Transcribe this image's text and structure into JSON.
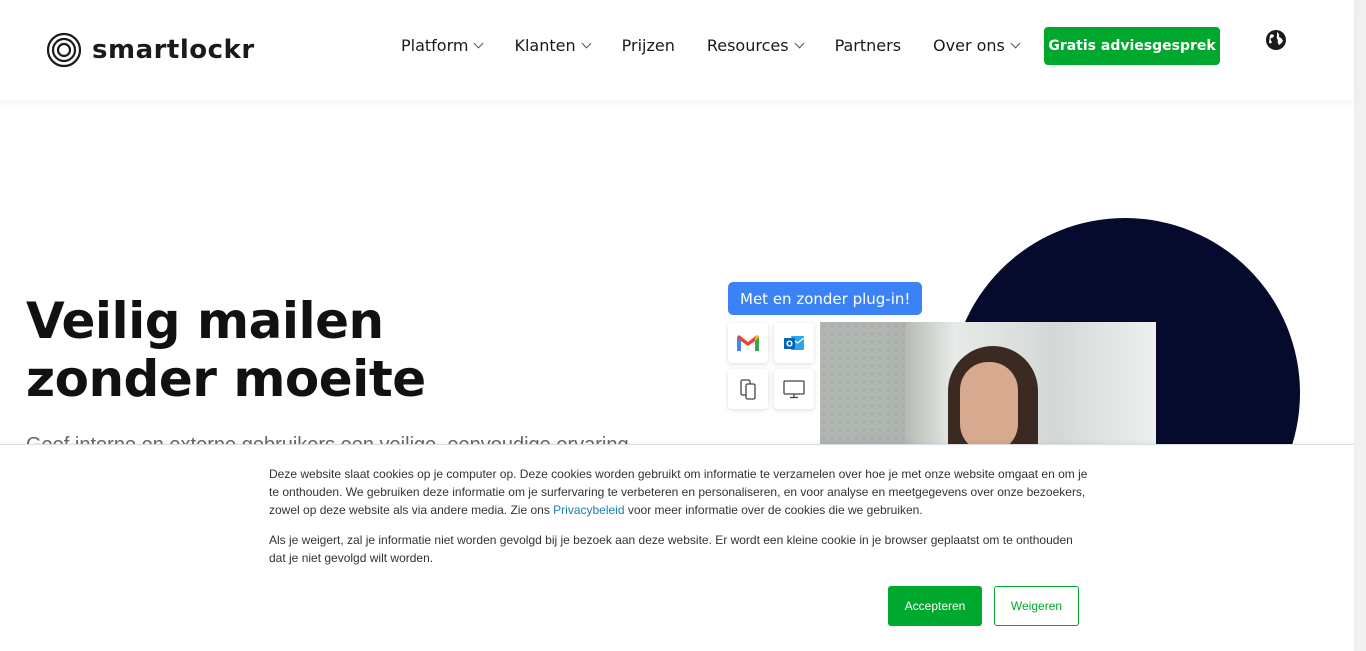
{
  "brand": {
    "name": "smartlockr"
  },
  "nav": {
    "items": [
      {
        "label": "Platform",
        "dropdown": true
      },
      {
        "label": "Klanten",
        "dropdown": true
      },
      {
        "label": "Prijzen",
        "dropdown": false
      },
      {
        "label": "Resources",
        "dropdown": true
      },
      {
        "label": "Partners",
        "dropdown": false
      },
      {
        "label": "Over ons",
        "dropdown": true
      }
    ],
    "cta_label": "Gratis adviesgesprek",
    "language_icon": "globe-icon"
  },
  "hero": {
    "title_line1": "Veilig mailen",
    "title_line2": "zonder moeite",
    "subtitle": "Geef interne en externe gebruikers een veilige, eenvoudige ervaring.",
    "badge": "Met en zonder plug-in!",
    "tiles": [
      "gmail-icon",
      "outlook-icon",
      "mobile-icon",
      "desktop-icon"
    ]
  },
  "cookie_banner": {
    "text1_before_link": "Deze website slaat cookies op je computer op. Deze cookies worden gebruikt om informatie te verzamelen over hoe je met onze website omgaat en om je te onthouden. We gebruiken deze informatie om je surfervaring te verbeteren en personaliseren, en voor analyse en meetgegevens over onze bezoekers, zowel op deze website als via andere media. Zie ons ",
    "link_label": "Privacybeleid",
    "text1_after_link": " voor meer informatie over de cookies die we gebruiken.",
    "text2": "Als je weigert, zal je informatie niet worden gevolgd bij je bezoek aan deze website. Er wordt een kleine cookie in je browser geplaatst om te onthouden dat je niet gevolgd wilt worden.",
    "accept_label": "Accepteren",
    "reject_label": "Weigeren"
  },
  "colors": {
    "accent": "#00a82d",
    "badge": "#3b82f6",
    "circle": "#060b2e",
    "link": "#1a7fb0"
  }
}
